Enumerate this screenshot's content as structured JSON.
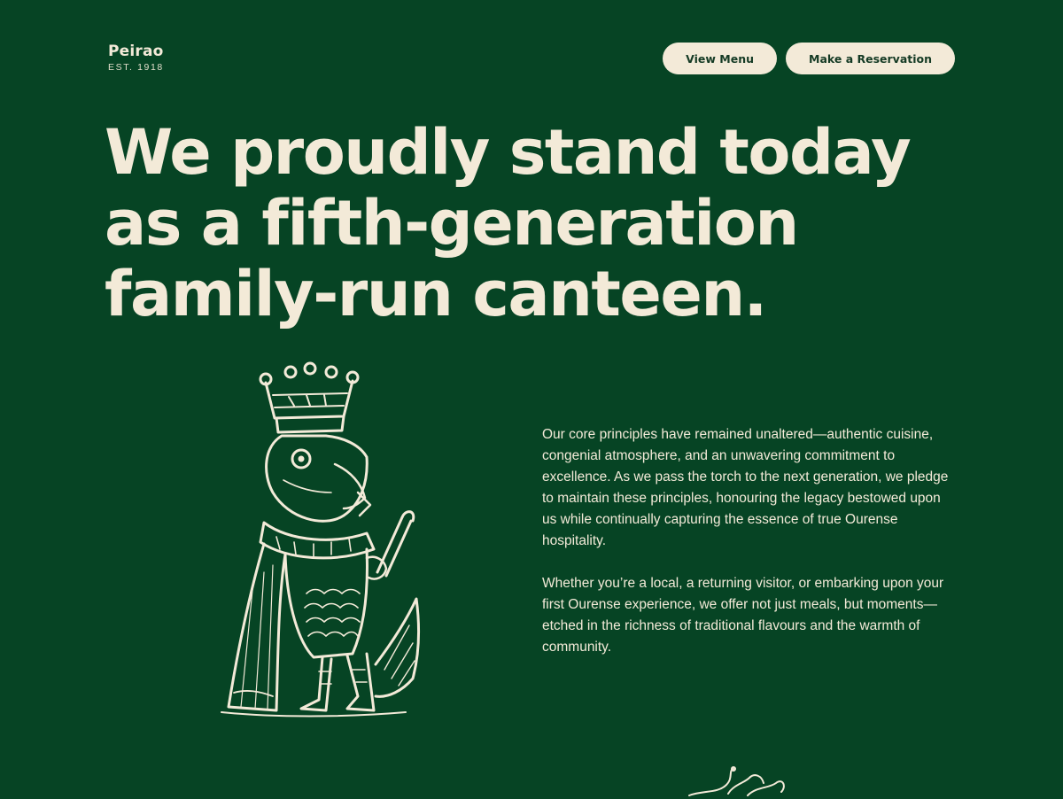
{
  "brand": {
    "name": "Peirao",
    "established": "EST. 1918"
  },
  "nav": {
    "view_menu": "View Menu",
    "reservation": "Make a Reservation"
  },
  "hero": {
    "headline": "We proudly stand today as a fifth-generation family-run canteen."
  },
  "body": {
    "paragraph_1": "Our core principles have remained unaltered—authentic cuisine, congenial atmosphere, and an unwavering commitment to excellence. As we pass the torch to the next generation, we pledge to maintain these principles, honouring the legacy bestowed upon us while continually capturing the essence of true Ourense hospitality.",
    "paragraph_2": "Whether you’re a local, a returning visitor, or embarking upon your first Ourense experience, we offer not just meals, but moments—etched in the richness of traditional flavours and the warmth of community."
  },
  "illustration": {
    "icon": "crowned-fish-king-icon"
  },
  "ornament": {
    "icon": "octopus-tentacles-icon"
  },
  "colors": {
    "background": "#064424",
    "cream": "#f3ead8",
    "button_text": "#143a24"
  }
}
